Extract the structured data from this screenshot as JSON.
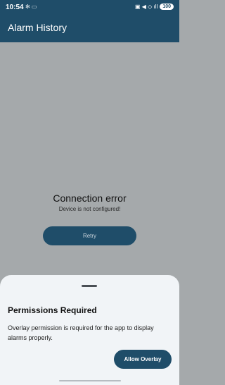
{
  "status_bar": {
    "time": "10:54",
    "left_icons_text": "✻ ▭",
    "right_icons_text": "▣ ◀ ◇ ıll",
    "battery": "100"
  },
  "app_bar": {
    "title": "Alarm History"
  },
  "main": {
    "error_title": "Connection error",
    "error_message": "Device is not configured!",
    "retry_label": "Retry"
  },
  "bottom_sheet": {
    "title": "Permissions Required",
    "message": "Overlay permission is required for the app to display alarms properly.",
    "allow_label": "Allow Overlay"
  },
  "colors": {
    "primary": "#1f4d69",
    "scrim": "#a5a9ab",
    "sheet": "#f1f4f7"
  }
}
